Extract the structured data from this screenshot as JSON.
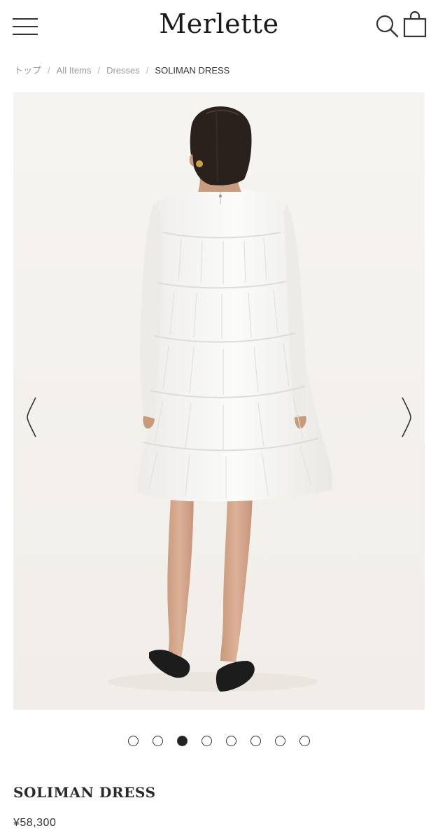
{
  "header": {
    "logo": "Merlette"
  },
  "breadcrumb": {
    "items": [
      "トップ",
      "All Items",
      "Dresses",
      "SOLIMAN DRESS"
    ],
    "separator": "/"
  },
  "gallery": {
    "image_alt": "Model wearing white tiered SOLIMAN DRESS, back view",
    "slide_count": 8,
    "active_slide": 3,
    "background": "#f6f4f1"
  },
  "product": {
    "name": "SOLIMAN DRESS",
    "price": "¥58,300"
  }
}
